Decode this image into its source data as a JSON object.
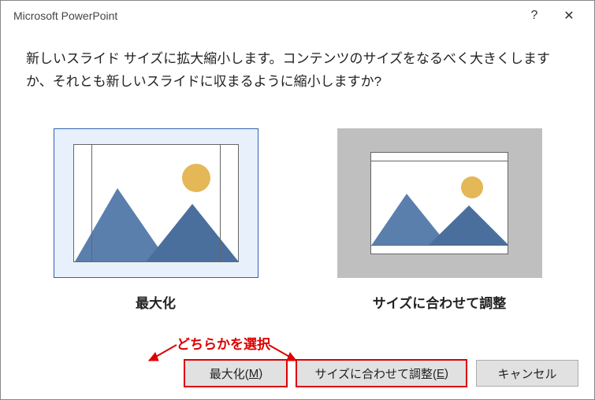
{
  "titlebar": {
    "title": "Microsoft PowerPoint",
    "help": "?",
    "close": "✕"
  },
  "message": "新しいスライド サイズに拡大縮小します。コンテンツのサイズをなるべく大きくしますか、それとも新しいスライドに収まるように縮小しますか?",
  "options": {
    "maximize_label": "最大化",
    "fit_label": "サイズに合わせて調整"
  },
  "annotation": "どちらかを選択",
  "buttons": {
    "maximize_pre": "最大化(",
    "maximize_key": "M",
    "maximize_post": ")",
    "fit_pre": "サイズに合わせて調整(",
    "fit_key": "E",
    "fit_post": ")",
    "cancel": "キャンセル"
  },
  "colors": {
    "accent": "#2a64b0",
    "highlight": "#d00"
  }
}
